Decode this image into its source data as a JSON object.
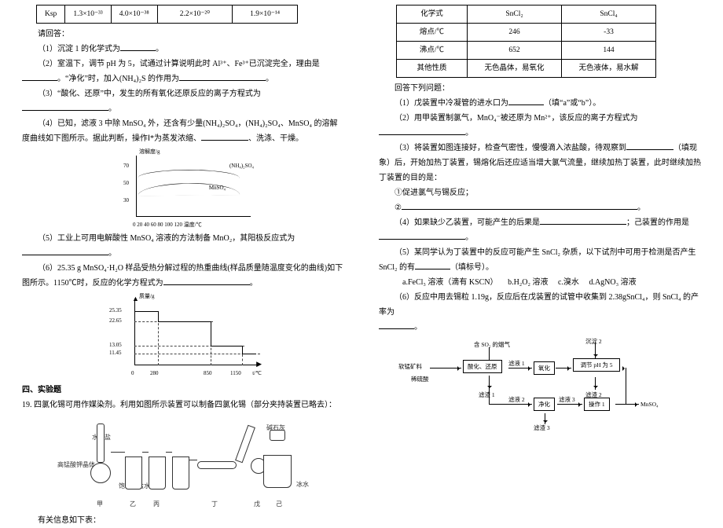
{
  "leftTable": {
    "h1": "Ksp",
    "c1": "1.3×10⁻³³",
    "c2": "4.0×10⁻³⁸",
    "c3": "2.2×10⁻²⁰",
    "c4": "1.9×10⁻¹⁴"
  },
  "left": {
    "qhd": "请回答：",
    "q1": "（1）沉淀 1 的化学式为",
    "q2a": "（2）室温下，调节 pH 为 5，试通过计算说明此时 Al³⁺、Fe³⁺已沉淀完全，理由是",
    "q2b": "。“净化”时，加入(NH₄)₂S 的作用为",
    "q3": "（3）“酸化、还原”中，发生的所有氧化还原反应的离子方程式为",
    "q4a": "（4）已知，滤液 3 中除 MnSO₄ 外，还含有少量(NH₄)₂SO₄，(NH₄)₂SO₄、MnSO₄ 的溶解度曲线如下图所示。据此判断，操作Ⅰ*为蒸发浓缩、",
    "q4b": "、洗涤、干燥。",
    "fig1": {
      "ylabel": "溶解度/g",
      "series1": "(NH₄)₂SO₄",
      "series2": "MnSO₄",
      "y70": "70",
      "y50": "50",
      "y30": "30",
      "xticks": "0  20 40 60 80 100 120  温度/℃"
    },
    "q5": "（5）工业上可用电解酸性 MnSO₄ 溶液的方法制备 MnO₂，其阳极反应式为",
    "q6a": "（6）25.35 g MnSO₄·H₂O 样品受热分解过程的热重曲线(样品质量随温度变化的曲线)如下图所示。1150℃时，反应的化学方程式为",
    "fig2": {
      "ylabel": "质量/g",
      "y1": "25.35",
      "y2": "22.65",
      "y3": "13.05",
      "y4": "11.45",
      "x1": "0",
      "x2": "280",
      "x3": "850",
      "x4": "1150",
      "xlabel": "t/℃"
    },
    "section4": "四、实验题",
    "q19": "19. 四氯化锡可用作媒染剂。利用如图所示装置可以制备四氯化锡（部分夹持装置已略去）：",
    "fig3": {
      "lbl_salt": "水和盐",
      "lbl_kmno4": "高锰酸钾晶体",
      "lbl_hcl": "饱和食盐水",
      "lbl_soda": "碱石灰",
      "lbl_ice": "冰水",
      "a": "甲",
      "b": "乙",
      "c": "丙",
      "d": "丁",
      "e": "戊",
      "f": "己"
    },
    "info": "有关信息如下表："
  },
  "rightTable": {
    "h1": "化学式",
    "h2": "SnCl₂",
    "h3": "SnCl₄",
    "r2a": "熔点/℃",
    "r2b": "246",
    "r2c": "-33",
    "r3a": "沸点/℃",
    "r3b": "652",
    "r3c": "144",
    "r4a": "其他性质",
    "r4b": "无色晶体，易氧化",
    "r4c": "无色液体，易水解"
  },
  "right": {
    "head": "回答下列问题：",
    "q1": "（1）戊装置中冷凝管的进水口为",
    "q1b": "（填“a”或“b”）。",
    "q2": "（2）用甲装置制氯气，MnO₄⁻被还原为 Mn²⁺，该反应的离子方程式为",
    "q3a": "（3）将装置如图连接好，检查气密性，慢慢滴入浓盐酸，待观察到",
    "q3b": "（填现象）后，开始加热丁装置，锡熔化后还应适当增大氯气流量，继续加热丁装置，此时继续加热丁装置的目的是：",
    "q3c": "①促进氯气与锡反应；",
    "q3d": "②",
    "q4a": "（4）如果缺少乙装置，可能产生的后果是",
    "q4b": "；己装置的作用是",
    "q5a": "（5）某同学认为丁装置中的反应可能产生 SnCl₂ 杂质，以下试剂中可用于检测是否产生 SnCl₂ 的有",
    "q5b": "（填标号）。",
    "opt_a": "a.FeCl₃ 溶液（滴有 KSCN）",
    "opt_b": "b.H₂O₂ 溶液",
    "opt_c": "c.溴水",
    "opt_d": "d.AgNO₃ 溶液",
    "q6": "（6）反应中用去锡粒 1.19g，反应后在戊装置的试管中收集到 2.38gSnCl₄，则 SnCl₄ 的产率为",
    "flow": {
      "gas": "含 SO₂ 的烟气",
      "ore": "软锰矿料",
      "dilute": "稀硫酸",
      "n1": "酸化、还原",
      "n2": "滤渣 1",
      "n3": "氧化",
      "n4": "调节 pH 为 5",
      "n4b": "滤渣 2",
      "n5": "沉淀 2",
      "n6": "净化",
      "n6b": "滤渣 3",
      "n7": "操作 1",
      "out": "MnSO₄",
      "f1": "滤液 1",
      "f2": "滤液 2",
      "f3": "滤液 3"
    }
  }
}
